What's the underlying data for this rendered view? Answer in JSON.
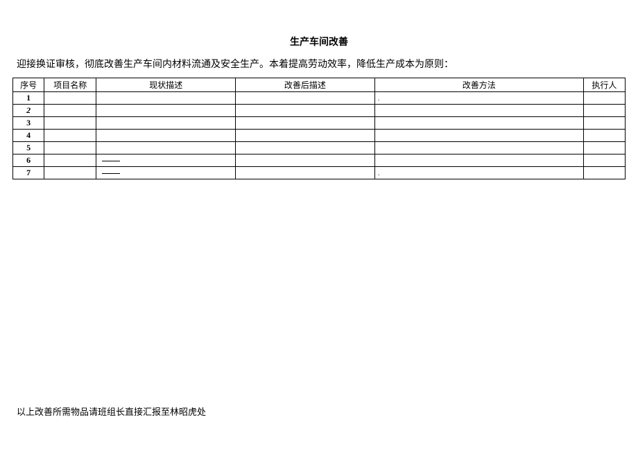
{
  "title": "生产车间改善",
  "intro": "迎接换证审核，彻底改善生产车间内材料流通及安全生产。本着提高劳动效率，降低生产成本为原则：",
  "headers": {
    "seq": "序号",
    "name": "项目名称",
    "current": "现状描述",
    "after": "改善后描述",
    "method": "改善方法",
    "executor": "执行人"
  },
  "rows": [
    {
      "seq": "1",
      "italic": false,
      "name": "",
      "current": "",
      "after": "",
      "method": ".",
      "executor": ""
    },
    {
      "seq": "2",
      "italic": true,
      "name": "",
      "current": "",
      "after": "",
      "method": "",
      "executor": ""
    },
    {
      "seq": "3",
      "italic": false,
      "name": "",
      "current": "",
      "after": "",
      "method": "",
      "executor": ""
    },
    {
      "seq": "4",
      "italic": false,
      "name": "",
      "current": "",
      "after": "",
      "method": "",
      "executor": ""
    },
    {
      "seq": "5",
      "italic": false,
      "name": "",
      "current": "",
      "after": "",
      "method": "",
      "executor": ""
    },
    {
      "seq": "6",
      "italic": false,
      "name": "",
      "current": "dash",
      "after": "",
      "method": "",
      "executor": ""
    },
    {
      "seq": "7",
      "italic": false,
      "name": "",
      "current": "dash",
      "after": "",
      "method": ".",
      "executor": ""
    }
  ],
  "footer": "以上改善所需物品请班组长直接汇报至林昭虎处"
}
